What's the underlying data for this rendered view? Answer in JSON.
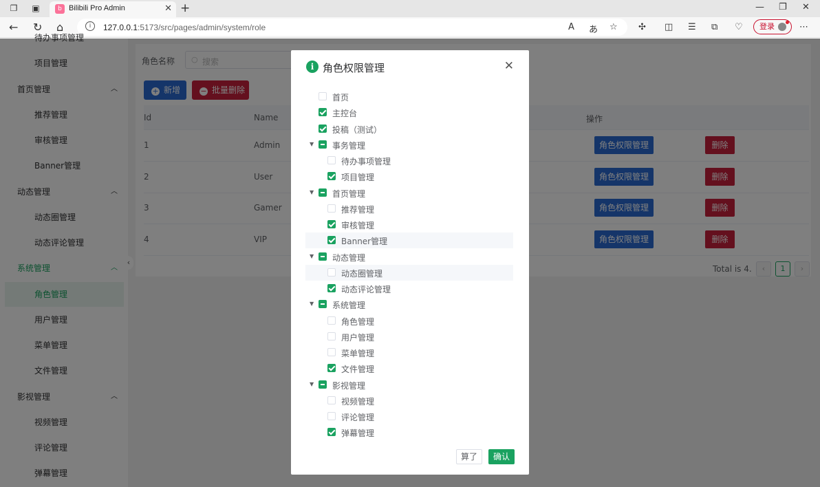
{
  "browser": {
    "tab_title": "Bilibili Pro Admin",
    "url_host": "127.0.0.1",
    "url_rest": ":5173/src/pages/admin/system/role",
    "login_label": "登录"
  },
  "sidebar": {
    "items": [
      {
        "label": "待办事项管理",
        "type": "sub"
      },
      {
        "label": "项目管理",
        "type": "sub"
      },
      {
        "label": "首页管理",
        "type": "group"
      },
      {
        "label": "推荐管理",
        "type": "sub"
      },
      {
        "label": "审核管理",
        "type": "sub"
      },
      {
        "label": "Banner管理",
        "type": "sub"
      },
      {
        "label": "动态管理",
        "type": "group"
      },
      {
        "label": "动态圈管理",
        "type": "sub"
      },
      {
        "label": "动态评论管理",
        "type": "sub"
      },
      {
        "label": "系统管理",
        "type": "group",
        "active": true
      },
      {
        "label": "角色管理",
        "type": "sub",
        "active": true
      },
      {
        "label": "用户管理",
        "type": "sub"
      },
      {
        "label": "菜单管理",
        "type": "sub"
      },
      {
        "label": "文件管理",
        "type": "sub"
      },
      {
        "label": "影视管理",
        "type": "group"
      },
      {
        "label": "视频管理",
        "type": "sub"
      },
      {
        "label": "评论管理",
        "type": "sub"
      },
      {
        "label": "弹幕管理",
        "type": "sub"
      }
    ]
  },
  "search": {
    "label": "角色名称",
    "placeholder": "搜索"
  },
  "toolbar": {
    "add_label": "新增",
    "batch_delete_label": "批量删除"
  },
  "table": {
    "columns": [
      "Id",
      "Name",
      "操作"
    ],
    "rows": [
      {
        "id": "1",
        "name": "Admin"
      },
      {
        "id": "2",
        "name": "User"
      },
      {
        "id": "3",
        "name": "Gamer"
      },
      {
        "id": "4",
        "name": "VIP"
      }
    ],
    "perm_label": "角色权限管理",
    "delete_label": "删除"
  },
  "pagination": {
    "total": "Total is 4.",
    "current": "1"
  },
  "dialog": {
    "title": "角色权限管理",
    "tree": [
      {
        "label": "首页",
        "level": 0,
        "state": "unchecked",
        "caret": false
      },
      {
        "label": "主控台",
        "level": 0,
        "state": "checked",
        "caret": false
      },
      {
        "label": "投稿（测试）",
        "level": 0,
        "state": "checked",
        "caret": false
      },
      {
        "label": "事务管理",
        "level": 0,
        "state": "indeterminate",
        "caret": true
      },
      {
        "label": "待办事项管理",
        "level": 1,
        "state": "unchecked"
      },
      {
        "label": "项目管理",
        "level": 1,
        "state": "checked"
      },
      {
        "label": "首页管理",
        "level": 0,
        "state": "indeterminate",
        "caret": true
      },
      {
        "label": "推荐管理",
        "level": 1,
        "state": "unchecked"
      },
      {
        "label": "审核管理",
        "level": 1,
        "state": "checked"
      },
      {
        "label": "Banner管理",
        "level": 1,
        "state": "checked",
        "highlight": true
      },
      {
        "label": "动态管理",
        "level": 0,
        "state": "indeterminate",
        "caret": true
      },
      {
        "label": "动态圈管理",
        "level": 1,
        "state": "unchecked",
        "highlight": true
      },
      {
        "label": "动态评论管理",
        "level": 1,
        "state": "checked"
      },
      {
        "label": "系统管理",
        "level": 0,
        "state": "indeterminate",
        "caret": true
      },
      {
        "label": "角色管理",
        "level": 1,
        "state": "unchecked"
      },
      {
        "label": "用户管理",
        "level": 1,
        "state": "unchecked"
      },
      {
        "label": "菜单管理",
        "level": 1,
        "state": "unchecked"
      },
      {
        "label": "文件管理",
        "level": 1,
        "state": "checked"
      },
      {
        "label": "影视管理",
        "level": 0,
        "state": "indeterminate",
        "caret": true
      },
      {
        "label": "视频管理",
        "level": 1,
        "state": "unchecked"
      },
      {
        "label": "评论管理",
        "level": 1,
        "state": "unchecked"
      },
      {
        "label": "弹幕管理",
        "level": 1,
        "state": "checked"
      }
    ],
    "cancel_label": "算了",
    "confirm_label": "确认"
  },
  "colors": {
    "primary": "#1aa260",
    "blue": "#2b6bd2",
    "danger": "#c8203c"
  }
}
